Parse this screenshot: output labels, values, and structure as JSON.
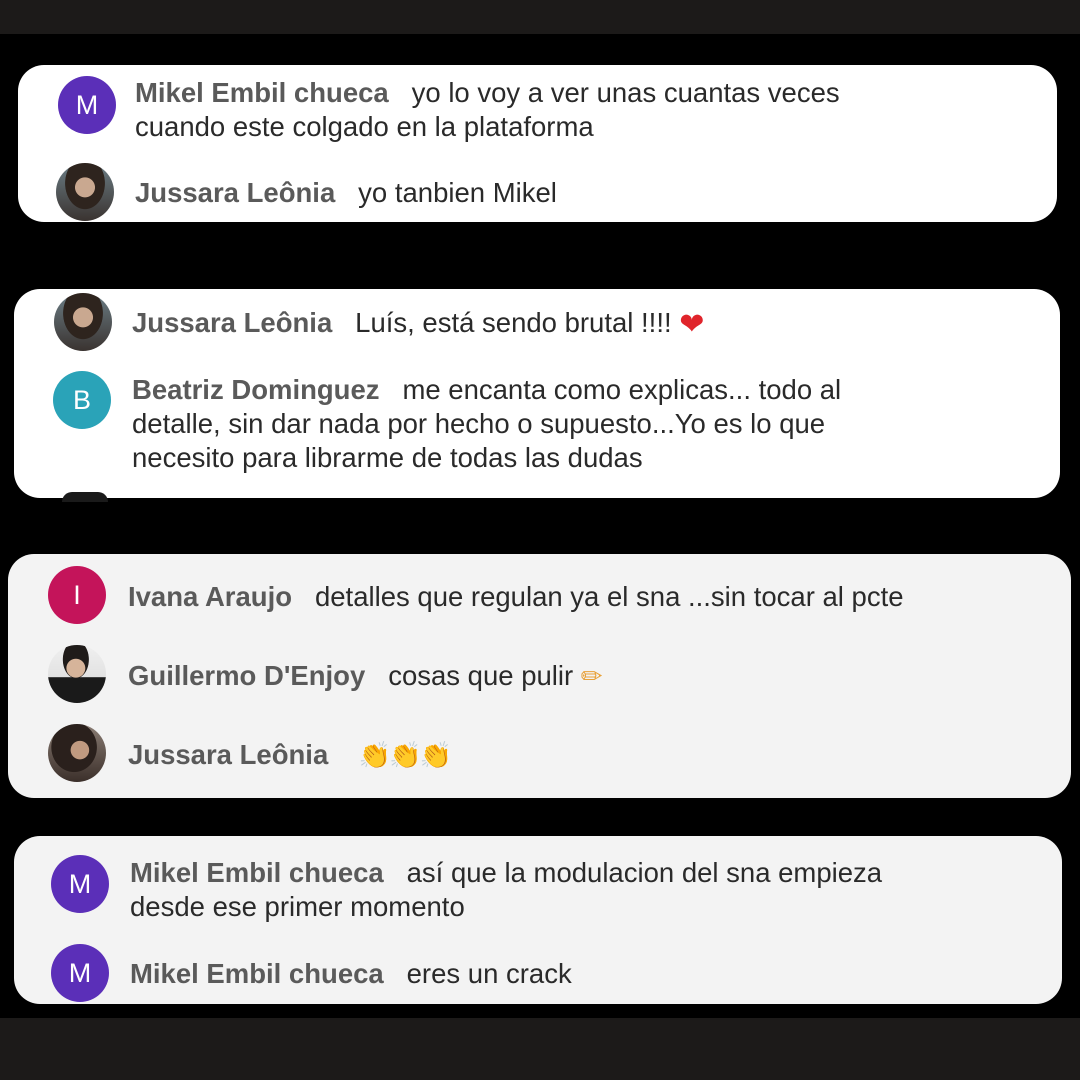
{
  "colors": {
    "avatar_m": "#5b2fb8",
    "avatar_b": "#2aa3b8",
    "avatar_i": "#c4145a"
  },
  "cards": [
    {
      "comments": [
        {
          "initial": "M",
          "name": "Mikel Embil chueca",
          "text": "yo lo voy a ver unas cuantas veces",
          "text2": "cuando este colgado en la plataforma"
        },
        {
          "name": "Jussara Leônia",
          "text": "yo tanbien Mikel"
        }
      ]
    },
    {
      "comments": [
        {
          "name": "Jussara Leônia",
          "text": "Luís, está sendo brutal !!!!",
          "emoji": "❤"
        },
        {
          "initial": "B",
          "name": "Beatriz Dominguez",
          "text": "me encanta como explicas... todo al",
          "text2": "detalle, sin dar nada por hecho o supuesto...Yo es lo que",
          "text3": "necesito para librarme de todas las dudas"
        }
      ]
    },
    {
      "comments": [
        {
          "initial": "I",
          "name": "Ivana Araujo",
          "text": "detalles que regulan ya el sna ...sin tocar al pcte"
        },
        {
          "name": "Guillermo D'Enjoy",
          "text": "cosas que pulir",
          "emoji": "✏"
        },
        {
          "name": "Jussara Leônia",
          "emoji": "👏👏👏"
        }
      ]
    },
    {
      "comments": [
        {
          "initial": "M",
          "name": "Mikel Embil chueca",
          "text": "así que la modulacion del sna empieza",
          "text2": "desde ese primer momento"
        },
        {
          "initial": "M",
          "name": "Mikel Embil chueca",
          "text": "eres un crack"
        }
      ]
    }
  ]
}
